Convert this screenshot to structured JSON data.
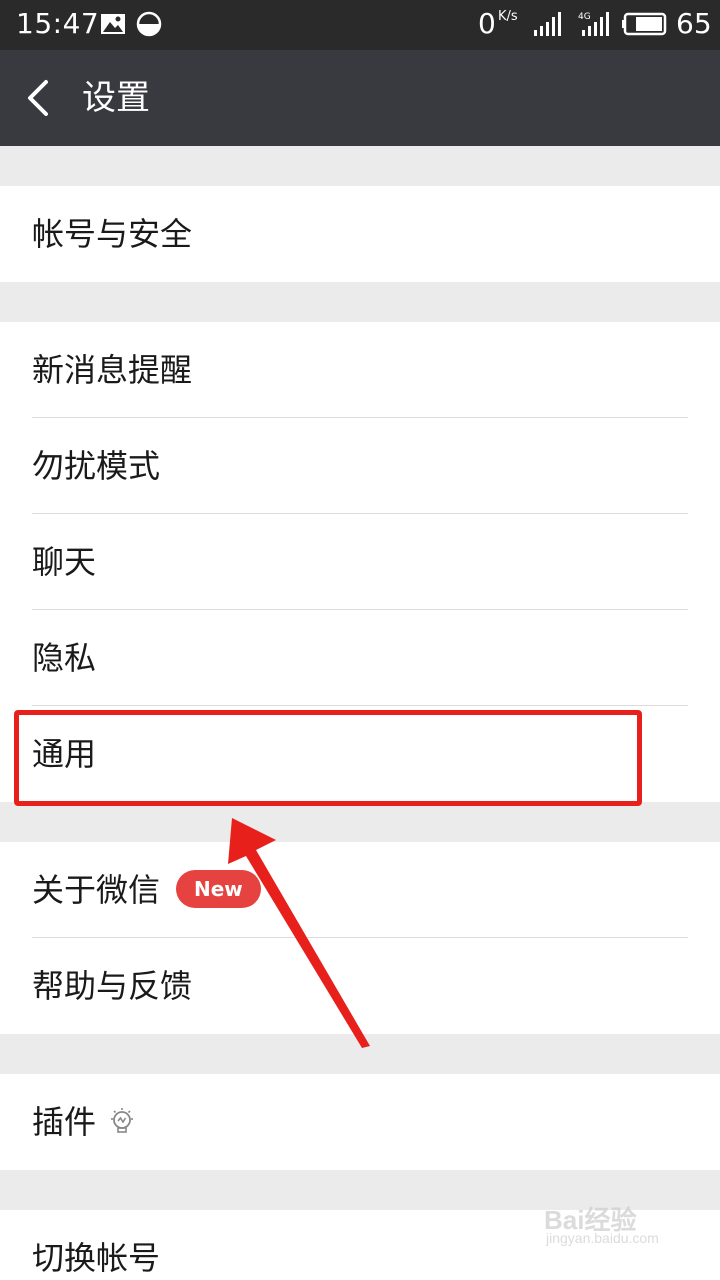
{
  "status_bar": {
    "time": "15:47",
    "net_speed": "0",
    "net_speed_unit": "K/s",
    "network_type": "4G",
    "battery": "65",
    "icons": [
      "image-icon",
      "data-saver-icon",
      "signal-icon",
      "signal-4g-icon",
      "battery-icon"
    ]
  },
  "header": {
    "title": "设置",
    "back_icon": "chevron-left-icon"
  },
  "settings": {
    "account_security": "帐号与安全",
    "new_message_alert": "新消息提醒",
    "do_not_disturb": "勿扰模式",
    "chat": "聊天",
    "privacy": "隐私",
    "general": "通用",
    "about_wechat": "关于微信",
    "about_badge": "New",
    "help_feedback": "帮助与反馈",
    "plugins": "插件",
    "plugins_icon": "lightbulb-icon",
    "switch_account": "切换帐号"
  },
  "annotation": {
    "highlight_color": "#e8201b"
  },
  "watermark": {
    "line1": "Bai经验",
    "line2": "jingyan.baidu.com"
  },
  "colors": {
    "status_bar": "#2a2a2a",
    "header": "#393a3f",
    "background": "#ebebeb",
    "badge": "#e64340"
  }
}
